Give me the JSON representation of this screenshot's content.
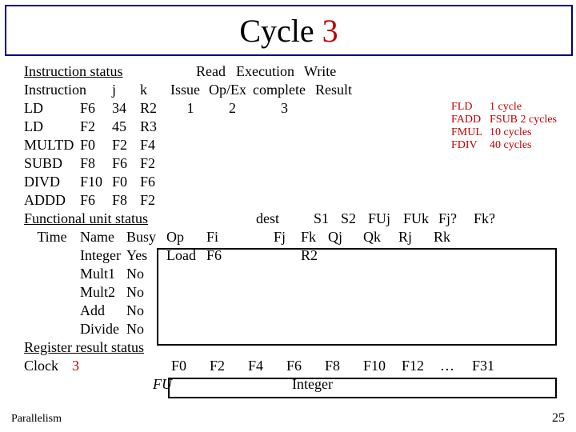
{
  "title_prefix": "Cycle ",
  "title_number": "3",
  "section1": "Instruction status",
  "hdr_read": "Read",
  "hdr_exec": "Execution",
  "hdr_write": "Write",
  "hdr_instr": "Instruction",
  "hdr_j": "j",
  "hdr_k": "k",
  "hdr_issue": "Issue",
  "hdr_opex": "Op/Ex",
  "hdr_complete": "complete",
  "hdr_result": "Result",
  "instructions": [
    {
      "op": "LD",
      "d": "F6",
      "j": "34",
      "k": "R2",
      "issue": "1",
      "read": "2",
      "exec": "3",
      "write": ""
    },
    {
      "op": "LD",
      "d": "F2",
      "j": "45",
      "k": "R3",
      "issue": "",
      "read": "",
      "exec": "",
      "write": ""
    },
    {
      "op": "MULTD",
      "d": "F0",
      "j": "F2",
      "k": "F4",
      "issue": "",
      "read": "",
      "exec": "",
      "write": ""
    },
    {
      "op": "SUBD",
      "d": "F8",
      "j": "F6",
      "k": "F2",
      "issue": "",
      "read": "",
      "exec": "",
      "write": ""
    },
    {
      "op": "DIVD",
      "d": "F10",
      "j": "F0",
      "k": "F6",
      "issue": "",
      "read": "",
      "exec": "",
      "write": ""
    },
    {
      "op": "ADDD",
      "d": "F6",
      "j": "F8",
      "k": "F2",
      "issue": "",
      "read": "",
      "exec": "",
      "write": ""
    }
  ],
  "latencies": [
    {
      "op": "FLD",
      "val": "1 cycle"
    },
    {
      "op": "FADD",
      "val": "FSUB 2 cycles"
    },
    {
      "op": "FMUL",
      "val": "10 cycles"
    },
    {
      "op": "FDIV",
      "val": "40 cycles"
    }
  ],
  "section2": "Functional unit status",
  "fu_hdr1": {
    "dest": "dest",
    "s1": "S1",
    "s2": "S2",
    "fuj": "FUj",
    "fuk": "FUk",
    "fjq": "Fj?",
    "fkq": "Fk?"
  },
  "fu_hdr2": {
    "time": "Time",
    "name": "Name",
    "busy": "Busy",
    "op": "Op",
    "fi": "Fi",
    "fj": "Fj",
    "fk": "Fk",
    "qj": "Qj",
    "qk": "Qk",
    "rj": "Rj",
    "rk": "Rk"
  },
  "fu_rows": [
    {
      "name": "Integer",
      "busy": "Yes",
      "op": "Load",
      "fi": "F6",
      "fj": "",
      "fk": "R2",
      "qj": "",
      "qk": "",
      "rj": "",
      "rk": ""
    },
    {
      "name": "Mult1",
      "busy": "No",
      "op": "",
      "fi": "",
      "fj": "",
      "fk": "",
      "qj": "",
      "qk": "",
      "rj": "",
      "rk": ""
    },
    {
      "name": "Mult2",
      "busy": "No",
      "op": "",
      "fi": "",
      "fj": "",
      "fk": "",
      "qj": "",
      "qk": "",
      "rj": "",
      "rk": ""
    },
    {
      "name": "Add",
      "busy": "No",
      "op": "",
      "fi": "",
      "fj": "",
      "fk": "",
      "qj": "",
      "qk": "",
      "rj": "",
      "rk": ""
    },
    {
      "name": "Divide",
      "busy": "No",
      "op": "",
      "fi": "",
      "fj": "",
      "fk": "",
      "qj": "",
      "qk": "",
      "rj": "",
      "rk": ""
    }
  ],
  "section3": "Register result status",
  "clock_label": "Clock",
  "clock_value": "3",
  "fu_label": "FU",
  "regs": [
    "F0",
    "F2",
    "F4",
    "F6",
    "F8",
    "F10",
    "F12",
    "…",
    "F31"
  ],
  "reg_fu": [
    "",
    "",
    "",
    "Integer",
    "",
    "",
    "",
    "",
    ""
  ],
  "footer_left": "Parallelism",
  "footer_right": "25"
}
